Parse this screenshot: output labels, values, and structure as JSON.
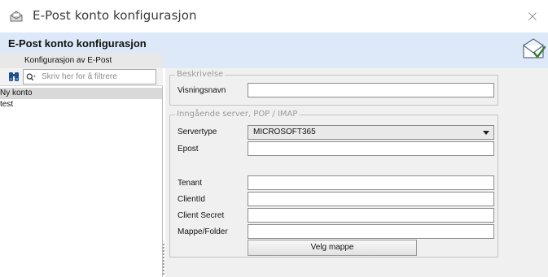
{
  "window": {
    "title": "E-Post konto konfigurasjon",
    "close_glyph": "×"
  },
  "header": {
    "title": "E-Post konto konfigurasjon",
    "subtitle": "Konfigurasjon av E-Post",
    "icon": "envelope-check-icon"
  },
  "left_pane": {
    "filter_placeholder": "Skriv her for å filtrere",
    "accounts": [
      {
        "label": "Ny konto",
        "selected": true
      },
      {
        "label": "test",
        "selected": false
      }
    ]
  },
  "form": {
    "description_group": {
      "legend": "Beskrivelse",
      "display_name_label": "Visningsnavn",
      "display_name_value": ""
    },
    "incoming_group": {
      "legend": "Inngående server, POP / IMAP",
      "server_type_label": "Servertype",
      "server_type_value": "MICROSOFT365",
      "email_label": "Epost",
      "email_value": "",
      "tenant_label": "Tenant",
      "tenant_value": "",
      "client_id_label": "ClientId",
      "client_id_value": "",
      "client_secret_label": "Client Secret",
      "client_secret_value": "",
      "folder_label": "Mappe/Folder",
      "folder_value": "",
      "choose_folder_button": "Velg mappe"
    }
  },
  "colors": {
    "header_band": "#dde9f8",
    "right_pane_bg": "#f0f0f0",
    "selected_row": "#d9d9d9"
  }
}
